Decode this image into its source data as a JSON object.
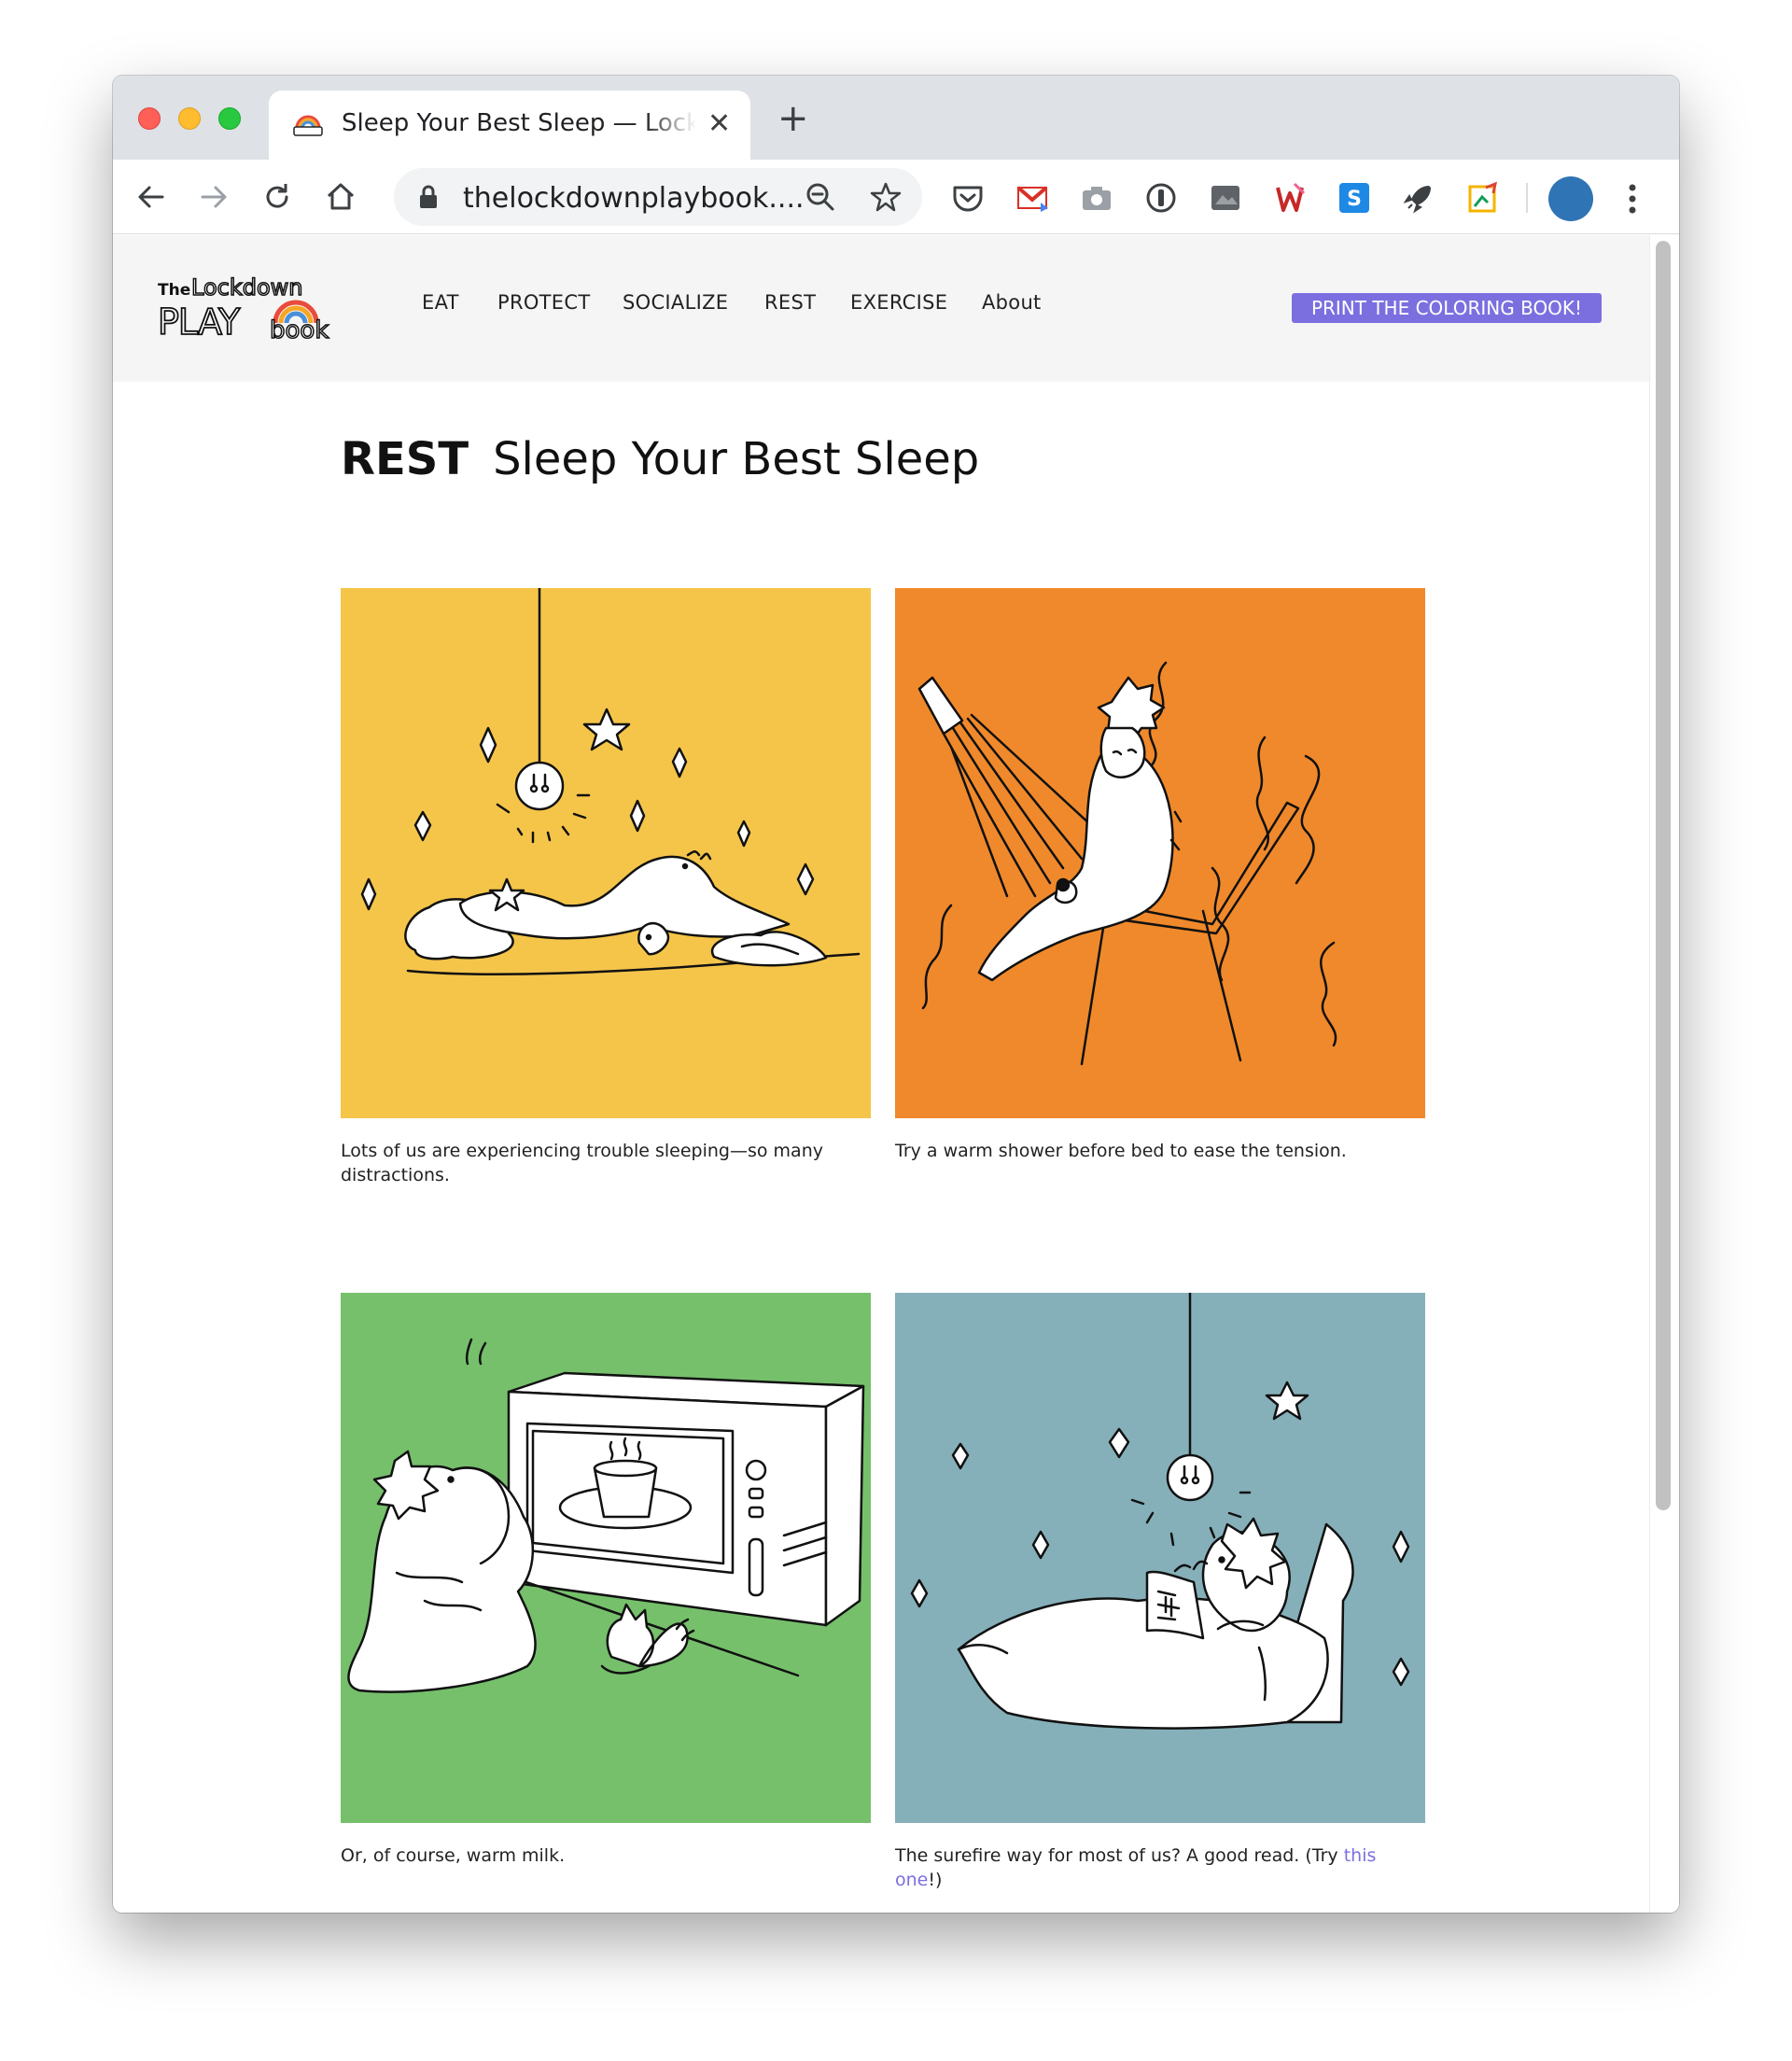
{
  "browser": {
    "tab_title": "Sleep Your Best Sleep — Lockdown Playbook",
    "url": "thelockdownplaybook....",
    "new_tab": "+",
    "close": "✕"
  },
  "site": {
    "logo_text": "The Lockdown PLAY book",
    "nav": [
      "EAT",
      "PROTECT",
      "SOCIALIZE",
      "REST",
      "EXERCISE",
      "About"
    ],
    "cta": "PRINT THE COLORING BOOK!"
  },
  "page": {
    "category": "REST",
    "title": "Sleep Your Best Sleep"
  },
  "panels": [
    {
      "color": "#f5c54a",
      "caption": "Lots of us are experiencing trouble sleeping—so many distractions."
    },
    {
      "color": "#f0892b",
      "caption": "Try a warm shower before bed to ease the tension."
    },
    {
      "color": "#76c06c",
      "caption": "Or, of course, warm milk."
    },
    {
      "color": "#86b0b9",
      "caption_before": "The surefire way for most of us? A good read. (Try ",
      "caption_link": "this one",
      "caption_after": "!)"
    }
  ],
  "icons": {
    "back": "arrow-left-icon",
    "forward": "arrow-right-icon",
    "reload": "reload-icon",
    "home": "home-icon",
    "lock": "lock-icon",
    "zoom": "zoom-out-icon",
    "star": "bookmark-star-icon",
    "menu": "kebab-menu-icon"
  }
}
